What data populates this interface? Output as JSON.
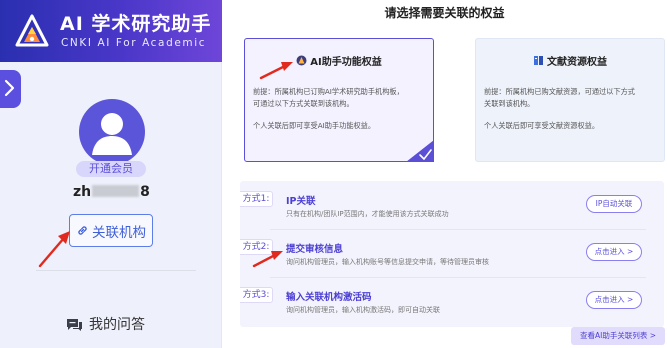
{
  "brand": {
    "name": "AI 学术研究助手",
    "subtitle": "CNKI AI For Academic"
  },
  "profile": {
    "vip_label": "开通会员",
    "username_prefix": "zh",
    "username_suffix": "8"
  },
  "sidebar": {
    "link_institution_label": "关联机构",
    "my_qa_label": "我的问答"
  },
  "main": {
    "title": "请选择需要关联的权益",
    "cards": [
      {
        "title": "AI助手功能权益",
        "line1": "前提：所属机构已订购AI学术研究助手机构板，",
        "line2": "可通过以下方式关联到该机构。",
        "note": "个人关联后即可享受AI助手功能权益。",
        "selected": true
      },
      {
        "title": "文献资源权益",
        "line1": "前提：所属机构已购文献资源，可通过以下方式",
        "line2": "关联到该机构。",
        "note": "个人关联后即可享受文献资源权益。",
        "selected": false
      }
    ],
    "methods": [
      {
        "tag": "方式1:",
        "title": "IP关联",
        "desc": "只有在机构/团队IP范围内，才能使用该方式关联成功",
        "button": "IP自动关联"
      },
      {
        "tag": "方式2:",
        "title": "提交审核信息",
        "desc": "询问机构管理员，输入机构账号等信息提交申请，等待管理员审核",
        "button": "点击进入 >"
      },
      {
        "tag": "方式3:",
        "title": "输入关联机构激活码",
        "desc": "询问机构管理员，输入机构激活码，即可自动关联",
        "button": "点击进入 >"
      }
    ],
    "view_list_label": "查看AI助手关联列表 >"
  },
  "colors": {
    "brand_gradient_start": "#2a2fb0",
    "brand_gradient_end": "#6e46d9",
    "accent": "#5b4fd8",
    "link_blue": "#3f5fd6",
    "annotation_red": "#e02a1f"
  },
  "icons": {
    "logo": "cnki-ai-logo",
    "collapse": "chevron-right-icon",
    "avatar": "user-avatar-icon",
    "link": "link-icon",
    "qa": "chat-bubble-icon",
    "ai_card": "ai-assistant-icon",
    "lit_card": "book-icon",
    "selected": "check-icon"
  }
}
